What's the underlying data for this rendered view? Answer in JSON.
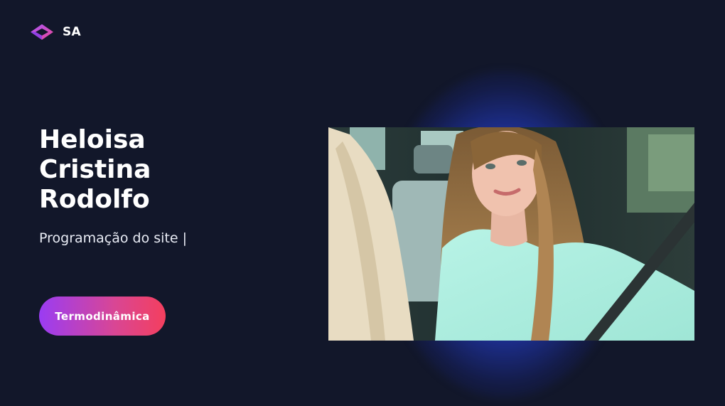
{
  "header": {
    "brand": "SA",
    "logo_icon": "cube-logo-icon"
  },
  "hero": {
    "name_lines": [
      "Heloisa",
      "Cristina",
      "Rodolfo"
    ],
    "subtitle": "Programação do site |",
    "cta_label": "Termodinâmica"
  },
  "colors": {
    "background": "#12172a",
    "text": "#ffffff",
    "glow": "#2d55ff",
    "button_gradient_start": "#9a3cf3",
    "button_gradient_end": "#f43f5e",
    "logo_start": "#a855f7",
    "logo_end": "#ec4899"
  }
}
